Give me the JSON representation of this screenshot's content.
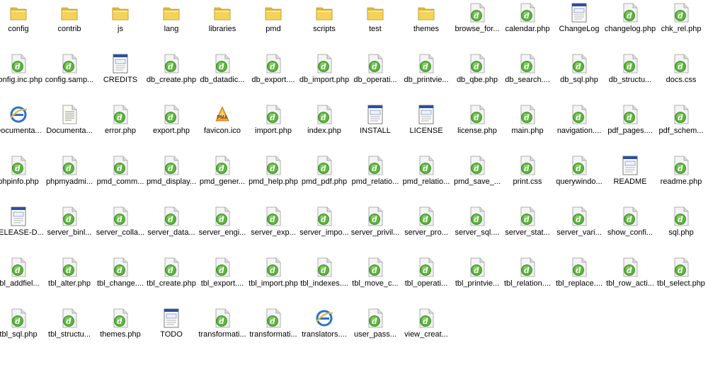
{
  "view": "icons",
  "colors": {
    "folder": "#f3d35a",
    "php_badge": "#5bb53a",
    "ie_blue": "#2a72c9"
  },
  "items": [
    {
      "label": "config",
      "icon": "folder-icon"
    },
    {
      "label": "contrib",
      "icon": "folder-icon"
    },
    {
      "label": "js",
      "icon": "folder-icon"
    },
    {
      "label": "lang",
      "icon": "folder-icon"
    },
    {
      "label": "libraries",
      "icon": "folder-icon"
    },
    {
      "label": "pmd",
      "icon": "folder-icon"
    },
    {
      "label": "scripts",
      "icon": "folder-icon"
    },
    {
      "label": "test",
      "icon": "folder-icon"
    },
    {
      "label": "themes",
      "icon": "folder-icon"
    },
    {
      "label": "browse_for...",
      "icon": "php-file-icon"
    },
    {
      "label": "calendar.php",
      "icon": "php-file-icon"
    },
    {
      "label": "ChangeLog",
      "icon": "text-window-file-icon"
    },
    {
      "label": "changelog.php",
      "icon": "php-file-icon"
    },
    {
      "label": "chk_rel.php",
      "icon": "php-file-icon"
    },
    {
      "label": "config.inc.php",
      "icon": "php-file-icon"
    },
    {
      "label": "config.samp...",
      "icon": "php-file-icon"
    },
    {
      "label": "CREDITS",
      "icon": "text-window-file-icon"
    },
    {
      "label": "db_create.php",
      "icon": "php-file-icon"
    },
    {
      "label": "db_datadic...",
      "icon": "php-file-icon"
    },
    {
      "label": "db_export....",
      "icon": "php-file-icon"
    },
    {
      "label": "db_import.php",
      "icon": "php-file-icon"
    },
    {
      "label": "db_operati...",
      "icon": "php-file-icon"
    },
    {
      "label": "db_printvie...",
      "icon": "php-file-icon"
    },
    {
      "label": "db_qbe.php",
      "icon": "php-file-icon"
    },
    {
      "label": "db_search....",
      "icon": "php-file-icon"
    },
    {
      "label": "db_sql.php",
      "icon": "php-file-icon"
    },
    {
      "label": "db_structu...",
      "icon": "php-file-icon"
    },
    {
      "label": "docs.css",
      "icon": "php-file-icon"
    },
    {
      "label": "Documenta...",
      "icon": "ie-html-icon"
    },
    {
      "label": "Documenta...",
      "icon": "text-document-icon"
    },
    {
      "label": "error.php",
      "icon": "php-file-icon"
    },
    {
      "label": "export.php",
      "icon": "php-file-icon"
    },
    {
      "label": "favicon.ico",
      "icon": "pma-logo-icon"
    },
    {
      "label": "import.php",
      "icon": "php-file-icon"
    },
    {
      "label": "index.php",
      "icon": "php-file-icon"
    },
    {
      "label": "INSTALL",
      "icon": "text-window-file-icon"
    },
    {
      "label": "LICENSE",
      "icon": "text-window-file-icon"
    },
    {
      "label": "license.php",
      "icon": "php-file-icon"
    },
    {
      "label": "main.php",
      "icon": "php-file-icon"
    },
    {
      "label": "navigation....",
      "icon": "php-file-icon"
    },
    {
      "label": "pdf_pages....",
      "icon": "php-file-icon"
    },
    {
      "label": "pdf_schem...",
      "icon": "php-file-icon"
    },
    {
      "label": "phpinfo.php",
      "icon": "php-file-icon"
    },
    {
      "label": "phpmyadmi...",
      "icon": "php-file-icon"
    },
    {
      "label": "pmd_comm...",
      "icon": "php-file-icon"
    },
    {
      "label": "pmd_display...",
      "icon": "php-file-icon"
    },
    {
      "label": "pmd_gener...",
      "icon": "php-file-icon"
    },
    {
      "label": "pmd_help.php",
      "icon": "php-file-icon"
    },
    {
      "label": "pmd_pdf.php",
      "icon": "php-file-icon"
    },
    {
      "label": "pmd_relatio...",
      "icon": "php-file-icon"
    },
    {
      "label": "pmd_relatio...",
      "icon": "php-file-icon"
    },
    {
      "label": "pmd_save_...",
      "icon": "php-file-icon"
    },
    {
      "label": "print.css",
      "icon": "php-file-icon"
    },
    {
      "label": "querywindo...",
      "icon": "php-file-icon"
    },
    {
      "label": "README",
      "icon": "text-window-file-icon"
    },
    {
      "label": "readme.php",
      "icon": "php-file-icon"
    },
    {
      "label": "RELEASE-D...",
      "icon": "text-window-file-icon"
    },
    {
      "label": "server_binl...",
      "icon": "php-file-icon"
    },
    {
      "label": "server_colla...",
      "icon": "php-file-icon"
    },
    {
      "label": "server_data...",
      "icon": "php-file-icon"
    },
    {
      "label": "server_engi...",
      "icon": "php-file-icon"
    },
    {
      "label": "server_exp...",
      "icon": "php-file-icon"
    },
    {
      "label": "server_impo...",
      "icon": "php-file-icon"
    },
    {
      "label": "server_privil...",
      "icon": "php-file-icon"
    },
    {
      "label": "server_pro...",
      "icon": "php-file-icon"
    },
    {
      "label": "server_sql....",
      "icon": "php-file-icon"
    },
    {
      "label": "server_stat...",
      "icon": "php-file-icon"
    },
    {
      "label": "server_vari...",
      "icon": "php-file-icon"
    },
    {
      "label": "show_confi...",
      "icon": "php-file-icon"
    },
    {
      "label": "sql.php",
      "icon": "php-file-icon"
    },
    {
      "label": "tbl_addfiel...",
      "icon": "php-file-icon"
    },
    {
      "label": "tbl_alter.php",
      "icon": "php-file-icon"
    },
    {
      "label": "tbl_change....",
      "icon": "php-file-icon"
    },
    {
      "label": "tbl_create.php",
      "icon": "php-file-icon"
    },
    {
      "label": "tbl_export....",
      "icon": "php-file-icon"
    },
    {
      "label": "tbl_import.php",
      "icon": "php-file-icon"
    },
    {
      "label": "tbl_indexes....",
      "icon": "php-file-icon"
    },
    {
      "label": "tbl_move_c...",
      "icon": "php-file-icon"
    },
    {
      "label": "tbl_operati...",
      "icon": "php-file-icon"
    },
    {
      "label": "tbl_printvie...",
      "icon": "php-file-icon"
    },
    {
      "label": "tbl_relation....",
      "icon": "php-file-icon"
    },
    {
      "label": "tbl_replace....",
      "icon": "php-file-icon"
    },
    {
      "label": "tbl_row_acti...",
      "icon": "php-file-icon"
    },
    {
      "label": "tbl_select.php",
      "icon": "php-file-icon"
    },
    {
      "label": "tbl_sql.php",
      "icon": "php-file-icon"
    },
    {
      "label": "tbl_structu...",
      "icon": "php-file-icon"
    },
    {
      "label": "themes.php",
      "icon": "php-file-icon"
    },
    {
      "label": "TODO",
      "icon": "text-window-file-icon"
    },
    {
      "label": "transformati...",
      "icon": "php-file-icon"
    },
    {
      "label": "transformati...",
      "icon": "php-file-icon"
    },
    {
      "label": "translators....",
      "icon": "ie-html-icon"
    },
    {
      "label": "user_pass...",
      "icon": "php-file-icon"
    },
    {
      "label": "view_creat...",
      "icon": "php-file-icon"
    }
  ]
}
